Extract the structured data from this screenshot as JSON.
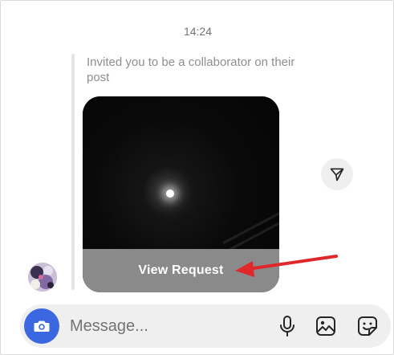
{
  "thread": {
    "timestamp": "14:24",
    "invite_text": "Invited you to be a collaborator on their post",
    "view_request_label": "View Request"
  },
  "composer": {
    "placeholder": "Message..."
  },
  "icons": {
    "share": "paper-plane-icon",
    "camera": "camera-icon",
    "microphone": "microphone-icon",
    "gallery": "image-icon",
    "sticker": "sticker-icon"
  },
  "colors": {
    "camera_button": "#3b67e0",
    "annotation_arrow": "#e0282b",
    "view_request_bar": "#8a8a8a",
    "composer_background": "#efefef"
  }
}
